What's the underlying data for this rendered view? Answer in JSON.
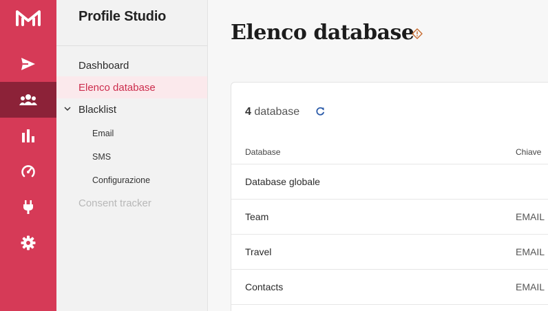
{
  "rail": {
    "items": [
      {
        "name": "send-icon"
      },
      {
        "name": "users-icon",
        "active": true
      },
      {
        "name": "bar-chart-icon"
      },
      {
        "name": "gauge-icon"
      },
      {
        "name": "plug-icon"
      },
      {
        "name": "gear-icon"
      }
    ],
    "colors": {
      "bg": "#d63a57",
      "active": "#8c2238"
    }
  },
  "sidebar": {
    "app_title": "Profile Studio",
    "items": [
      {
        "label": "Dashboard"
      },
      {
        "label": "Elenco database",
        "active": true
      },
      {
        "label": "Blacklist",
        "expanded": true
      },
      {
        "label": "Email"
      },
      {
        "label": "SMS"
      },
      {
        "label": "Configurazione"
      },
      {
        "label": "Consent tracker",
        "disabled": true
      }
    ]
  },
  "main": {
    "title": "Elenco database",
    "card": {
      "count_number": "4",
      "count_label": "database",
      "columns": [
        "Database",
        "Chiave"
      ],
      "rows": [
        {
          "database": "Database globale",
          "chiave": ""
        },
        {
          "database": "Team",
          "chiave": "EMAIL"
        },
        {
          "database": "Travel",
          "chiave": "EMAIL"
        },
        {
          "database": "Contacts",
          "chiave": "EMAIL"
        }
      ]
    }
  }
}
